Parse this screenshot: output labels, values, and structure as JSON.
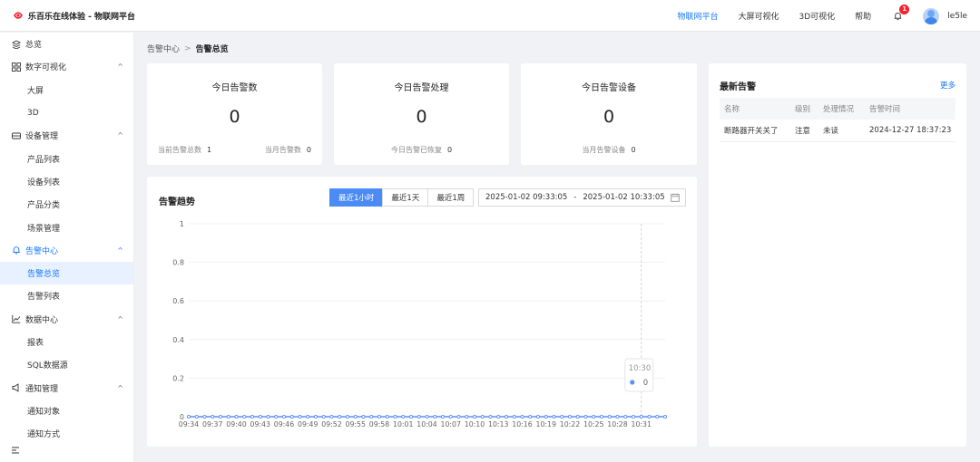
{
  "app": {
    "title": "乐百乐在线体验 - 物联网平台"
  },
  "topnav": {
    "items": [
      {
        "label": "物联网平台",
        "active": true
      },
      {
        "label": "大屏可视化",
        "active": false
      },
      {
        "label": "3D可视化",
        "active": false
      },
      {
        "label": "帮助",
        "active": false
      }
    ],
    "notification_count": "1",
    "username": "le5le"
  },
  "sidebar": {
    "items": [
      {
        "label": "总览",
        "icon": "overview-icon",
        "type": "top"
      },
      {
        "label": "数字可视化",
        "icon": "grid-icon",
        "type": "group",
        "chevron": "^"
      },
      {
        "label": "大屏",
        "type": "sub"
      },
      {
        "label": "3D",
        "type": "sub"
      },
      {
        "label": "设备管理",
        "icon": "device-icon",
        "type": "group",
        "chevron": "^"
      },
      {
        "label": "产品列表",
        "type": "sub"
      },
      {
        "label": "设备列表",
        "type": "sub"
      },
      {
        "label": "产品分类",
        "type": "sub"
      },
      {
        "label": "场景管理",
        "type": "sub"
      },
      {
        "label": "告警中心",
        "icon": "bell-icon",
        "type": "group",
        "chevron": "^",
        "active": true
      },
      {
        "label": "告警总览",
        "type": "sub",
        "selected": true
      },
      {
        "label": "告警列表",
        "type": "sub"
      },
      {
        "label": "数据中心",
        "icon": "chart-icon",
        "type": "group",
        "chevron": "^"
      },
      {
        "label": "报表",
        "type": "sub"
      },
      {
        "label": "SQL数据源",
        "type": "sub"
      },
      {
        "label": "通知管理",
        "icon": "megaphone-icon",
        "type": "group",
        "chevron": "^"
      },
      {
        "label": "通知对象",
        "type": "sub"
      },
      {
        "label": "通知方式",
        "type": "sub"
      }
    ]
  },
  "breadcrumb": {
    "parent": "告警中心",
    "separator": ">",
    "current": "告警总览"
  },
  "stats": {
    "today_alarms": {
      "title": "今日告警数",
      "value": "0",
      "foot1_label": "当前告警总数",
      "foot1_value": "1",
      "foot2_label": "当月告警数",
      "foot2_value": "0"
    },
    "today_handled": {
      "title": "今日告警处理",
      "value": "0",
      "foot_label": "今日告警已恢复",
      "foot_value": "0"
    },
    "today_devices": {
      "title": "今日告警设备",
      "value": "0",
      "foot_label": "当月告警设备",
      "foot_value": "0"
    }
  },
  "trend": {
    "title": "告警趋势",
    "ranges": [
      {
        "label": "最近1小时",
        "active": true
      },
      {
        "label": "最近1天",
        "active": false
      },
      {
        "label": "最近1周",
        "active": false
      }
    ],
    "date_start": "2025-01-02 09:33:05",
    "date_sep": "-",
    "date_end": "2025-01-02 10:33:05",
    "tooltip": {
      "time": "10:30",
      "value": "0"
    }
  },
  "recent": {
    "title": "最新告警",
    "more": "更多",
    "columns": [
      "名称",
      "级别",
      "处理情况",
      "告警时间"
    ],
    "rows": [
      [
        "断路器开关关了",
        "注意",
        "未读",
        "2024-12-27 18:37:23"
      ]
    ]
  },
  "colors": {
    "accent": "#1677ff",
    "line": "#5b8ff9",
    "badge": "#f5222d"
  },
  "chart_data": {
    "type": "line",
    "ylim": [
      0,
      1
    ],
    "yticks": [
      "0",
      "0.2",
      "0.4",
      "0.6",
      "0.8",
      "1"
    ],
    "x_tick_labels": [
      "09:34",
      "09:37",
      "09:40",
      "09:43",
      "09:46",
      "09:49",
      "09:52",
      "09:55",
      "09:58",
      "10:01",
      "10:04",
      "10:07",
      "10:10",
      "10:13",
      "10:16",
      "10:19",
      "10:22",
      "10:25",
      "10:28",
      "10:31"
    ],
    "point_count": 61,
    "series": [
      {
        "value_all": 0
      }
    ],
    "grid": true,
    "hover_index": 57
  }
}
